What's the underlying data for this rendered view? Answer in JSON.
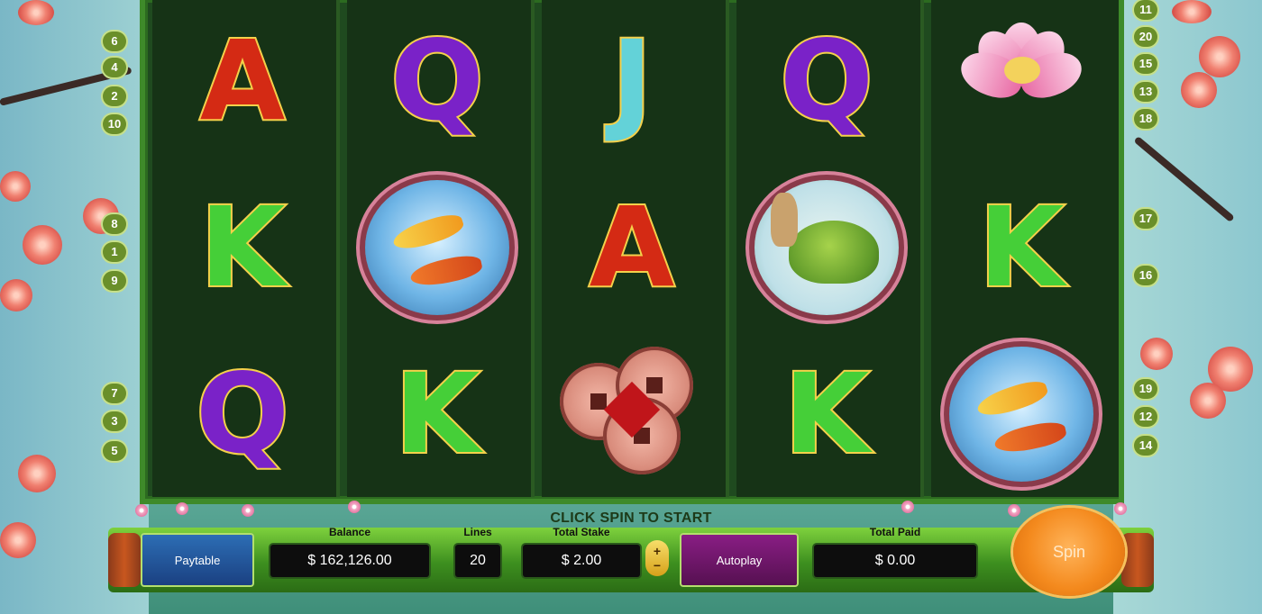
{
  "status_message": "CLICK SPIN TO START",
  "buttons": {
    "paytable": "Paytable",
    "autoplay": "Autoplay",
    "spin": "Spin"
  },
  "fields": {
    "balance": {
      "label": "Balance",
      "value": "$ 162,126.00"
    },
    "lines": {
      "label": "Lines",
      "value": "20"
    },
    "total_stake": {
      "label": "Total Stake",
      "value": "$ 2.00"
    },
    "total_paid": {
      "label": "Total Paid",
      "value": "$ 0.00"
    }
  },
  "stake_stepper": {
    "up": "+",
    "down": "−"
  },
  "reels": [
    [
      "A",
      "K",
      "Q"
    ],
    [
      "Q",
      "koi",
      "K"
    ],
    [
      "J",
      "A",
      "coins"
    ],
    [
      "Q",
      "turtle",
      "K"
    ],
    [
      "lotus",
      "K",
      "koi"
    ]
  ],
  "paylines": {
    "left": [
      "6",
      "4",
      "2",
      "10",
      "8",
      "1",
      "9",
      "7",
      "3",
      "5"
    ],
    "right": [
      "11",
      "20",
      "15",
      "13",
      "18",
      "17",
      "16",
      "19",
      "12",
      "14"
    ]
  },
  "colors": {
    "letter_A": "#d42a14",
    "letter_Q": "#7a22c8",
    "letter_J": "#63d2d8",
    "letter_K": "#45cf38",
    "reel_bg": "#163316",
    "bar_green": "#3d8f1f",
    "spin_orange": "#f48a1e"
  }
}
